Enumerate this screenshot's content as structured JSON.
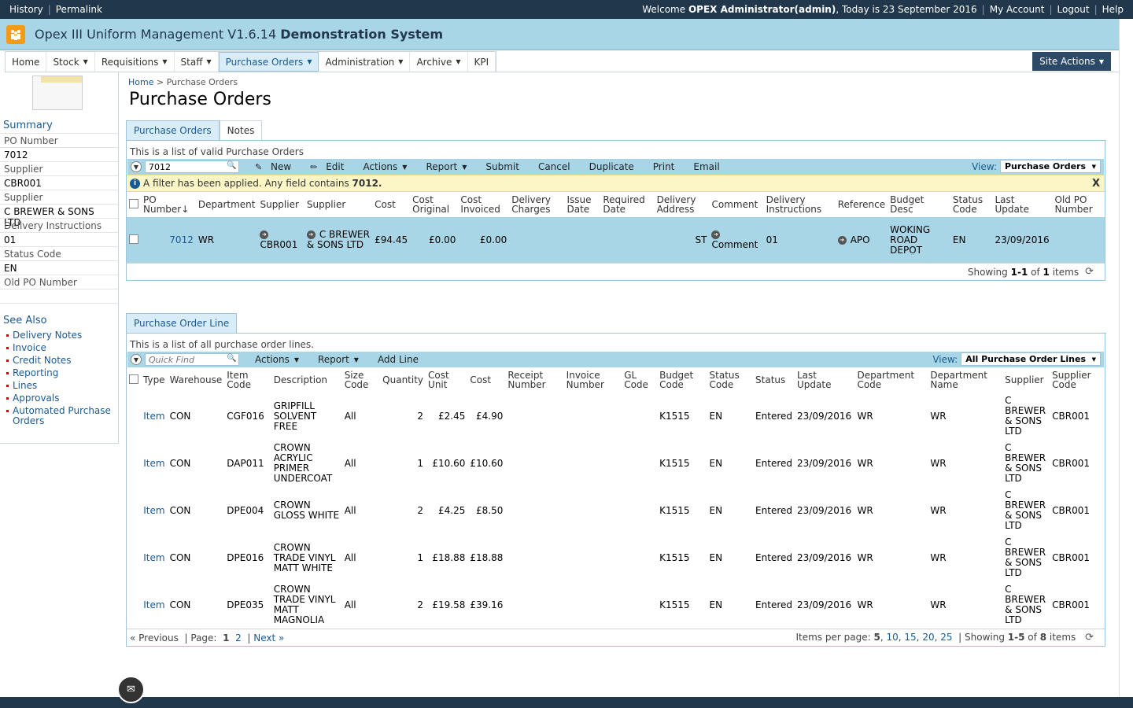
{
  "topbar": {
    "history": "History",
    "permalink": "Permalink",
    "welcome_prefix": "Welcome",
    "user": "OPEX Administrator(admin)",
    "date_text": ", Today is 23 September 2016",
    "my_account": "My Account",
    "logout": "Logout",
    "help": "Help"
  },
  "app": {
    "title": "Opex III Uniform Management V1.6.14",
    "system": "Demonstration System"
  },
  "nav": {
    "items": [
      {
        "label": "Home",
        "dropdown": false
      },
      {
        "label": "Stock",
        "dropdown": true
      },
      {
        "label": "Requisitions",
        "dropdown": true
      },
      {
        "label": "Staff",
        "dropdown": true
      },
      {
        "label": "Purchase Orders",
        "dropdown": true,
        "active": true
      },
      {
        "label": "Administration",
        "dropdown": true
      },
      {
        "label": "Archive",
        "dropdown": true
      },
      {
        "label": "KPI",
        "dropdown": false
      }
    ],
    "site_actions": "Site Actions"
  },
  "sidebar": {
    "summary": "Summary",
    "fields": [
      {
        "label": "PO Number",
        "value": "7012"
      },
      {
        "label": "Supplier",
        "value": "CBR001"
      },
      {
        "label": "Supplier",
        "value": "C BREWER & SONS LTD"
      },
      {
        "label": "Delivery Instructions",
        "value": "01"
      },
      {
        "label": "Status Code",
        "value": "EN"
      },
      {
        "label": "Old PO Number",
        "value": ""
      }
    ],
    "see_also": "See Also",
    "links": [
      "Delivery Notes",
      "Invoice",
      "Credit Notes",
      "Reporting",
      "Lines",
      "Approvals",
      "Automated Purchase Orders"
    ]
  },
  "breadcrumb": {
    "home": "Home",
    "sep": ">",
    "current": "Purchase Orders"
  },
  "page_title": "Purchase Orders",
  "po_panel": {
    "tabs": [
      "Purchase Orders",
      "Notes"
    ],
    "description": "This is a list of valid Purchase Orders",
    "filter_value": "7012",
    "toolbar": [
      "New",
      "Edit",
      "Actions",
      "Report",
      "Submit",
      "Cancel",
      "Duplicate",
      "Print",
      "Email"
    ],
    "view_label": "View:",
    "view_value": "Purchase Orders",
    "filter_msg": "A filter has been applied. Any field contains",
    "filter_term": "7012.",
    "close": "X",
    "columns": [
      "PO Number↓",
      "Department",
      "Supplier",
      "Supplier",
      "Cost",
      "Cost Original",
      "Cost Invoiced",
      "Delivery Charges",
      "Issue Date",
      "Required Date",
      "Delivery Address",
      "Comment",
      "Delivery Instructions",
      "Reference",
      "Budget Desc",
      "Status Code",
      "Last Update",
      "Old PO Number"
    ],
    "row": {
      "po_number": "7012",
      "department": "WR",
      "supplier_code": "CBR001",
      "supplier_name": "C BREWER & SONS LTD",
      "cost": "£94.45",
      "cost_original": "£0.00",
      "cost_invoiced": "£0.00",
      "delivery_charges": "",
      "issue_date": "",
      "required_date": "",
      "delivery_address": "ST",
      "comment": "Comment",
      "delivery_instructions": "01",
      "reference": "APO",
      "budget_desc": "WOKING ROAD DEPOT",
      "status_code": "EN",
      "last_update": "23/09/2016",
      "old_po": ""
    },
    "pager": {
      "showing": "Showing",
      "range": "1-1",
      "of": "of",
      "total": "1",
      "items": "items"
    }
  },
  "lines_panel": {
    "tab": "Purchase Order Line",
    "description": "This is a list of all purchase order lines.",
    "quick_find_placeholder": "Quick Find",
    "toolbar": [
      "Actions",
      "Report",
      "Add Line"
    ],
    "view_label": "View:",
    "view_value": "All Purchase Order Lines",
    "columns": [
      "Type",
      "Warehouse",
      "Item Code",
      "Description",
      "Size Code",
      "Quantity",
      "Cost Unit",
      "Cost",
      "Receipt Number",
      "Invoice Number",
      "GL Code",
      "Budget Code",
      "Status Code",
      "Status",
      "Last Update",
      "Department Code",
      "Department Name",
      "Supplier",
      "Supplier Code"
    ],
    "rows": [
      {
        "type": "Item",
        "warehouse": "CON",
        "item_code": "CGF016",
        "description": "GRIPFILL SOLVENT FREE",
        "size": "All",
        "qty": "2",
        "cost_unit": "£2.45",
        "cost": "£4.90",
        "receipt": "",
        "invoice": "",
        "gl": "",
        "budget": "K1515",
        "status_code": "EN",
        "status": "Entered",
        "last_update": "23/09/2016",
        "dept_code": "WR",
        "dept_name": "WR",
        "supplier": "C BREWER & SONS LTD",
        "supplier_code": "CBR001"
      },
      {
        "type": "Item",
        "warehouse": "CON",
        "item_code": "DAP011",
        "description": "CROWN ACRYLIC PRIMER UNDERCOAT",
        "size": "All",
        "qty": "1",
        "cost_unit": "£10.60",
        "cost": "£10.60",
        "receipt": "",
        "invoice": "",
        "gl": "",
        "budget": "K1515",
        "status_code": "EN",
        "status": "Entered",
        "last_update": "23/09/2016",
        "dept_code": "WR",
        "dept_name": "WR",
        "supplier": "C BREWER & SONS LTD",
        "supplier_code": "CBR001"
      },
      {
        "type": "Item",
        "warehouse": "CON",
        "item_code": "DPE004",
        "description": "CROWN GLOSS WHITE",
        "size": "All",
        "qty": "2",
        "cost_unit": "£4.25",
        "cost": "£8.50",
        "receipt": "",
        "invoice": "",
        "gl": "",
        "budget": "K1515",
        "status_code": "EN",
        "status": "Entered",
        "last_update": "23/09/2016",
        "dept_code": "WR",
        "dept_name": "WR",
        "supplier": "C BREWER & SONS LTD",
        "supplier_code": "CBR001"
      },
      {
        "type": "Item",
        "warehouse": "CON",
        "item_code": "DPE016",
        "description": "CROWN TRADE VINYL MATT WHITE",
        "size": "All",
        "qty": "1",
        "cost_unit": "£18.88",
        "cost": "£18.88",
        "receipt": "",
        "invoice": "",
        "gl": "",
        "budget": "K1515",
        "status_code": "EN",
        "status": "Entered",
        "last_update": "23/09/2016",
        "dept_code": "WR",
        "dept_name": "WR",
        "supplier": "C BREWER & SONS LTD",
        "supplier_code": "CBR001"
      },
      {
        "type": "Item",
        "warehouse": "CON",
        "item_code": "DPE035",
        "description": "CROWN TRADE VINYL MATT MAGNOLIA",
        "size": "All",
        "qty": "2",
        "cost_unit": "£19.58",
        "cost": "£39.16",
        "receipt": "",
        "invoice": "",
        "gl": "",
        "budget": "K1515",
        "status_code": "EN",
        "status": "Entered",
        "last_update": "23/09/2016",
        "dept_code": "WR",
        "dept_name": "WR",
        "supplier": "C BREWER & SONS LTD",
        "supplier_code": "CBR001"
      }
    ],
    "pager": {
      "previous": "« Previous",
      "page_label": "Page:",
      "pages": [
        "1",
        "2"
      ],
      "next": "Next »",
      "per_page_label": "Items per page:",
      "per_page": [
        "5",
        "10",
        "15",
        "20",
        "25"
      ],
      "showing": "Showing",
      "range": "1-5",
      "of": "of",
      "total": "8",
      "items": "items"
    }
  },
  "icons": {
    "logo": "people-icon",
    "mail": "mail-icon",
    "refresh": "refresh-icon"
  }
}
